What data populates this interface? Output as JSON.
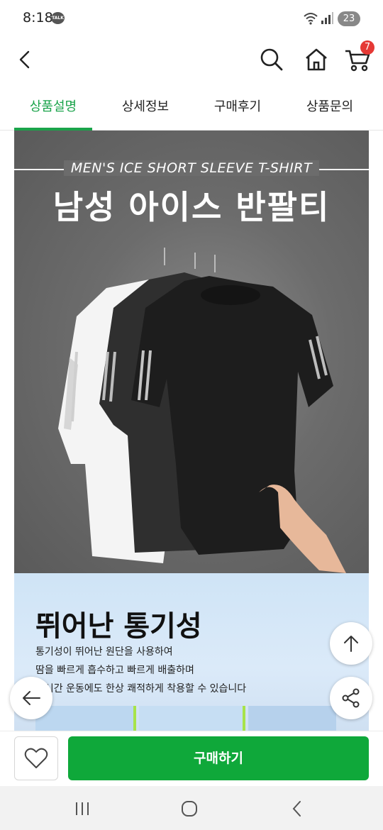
{
  "status": {
    "time": "8:18",
    "app_badge": "TALK",
    "battery": "23"
  },
  "header": {
    "cart_count": "7"
  },
  "tabs": [
    {
      "label": "상품설명",
      "active": true
    },
    {
      "label": "상세정보",
      "active": false
    },
    {
      "label": "구매후기",
      "active": false
    },
    {
      "label": "상품문의",
      "active": false
    }
  ],
  "hero": {
    "subtitle": "MEN'S ICE SHORT SLEEVE T-SHIRT",
    "title": "남성 아이스 반팔티"
  },
  "feature": {
    "title": "뛰어난 통기성",
    "lines": [
      "통기성이 뛰어난 원단을 사용하여",
      "땀을 빠르게 흡수하고 빠르게 배출하며",
      "장시간 운동에도 한상 쾌적하게 착용할 수 있습니다"
    ]
  },
  "bottom": {
    "buy_label": "구매하기"
  },
  "colors": {
    "accent": "#1aa34a",
    "buy": "#0fa83a",
    "badge": "#e53935"
  }
}
